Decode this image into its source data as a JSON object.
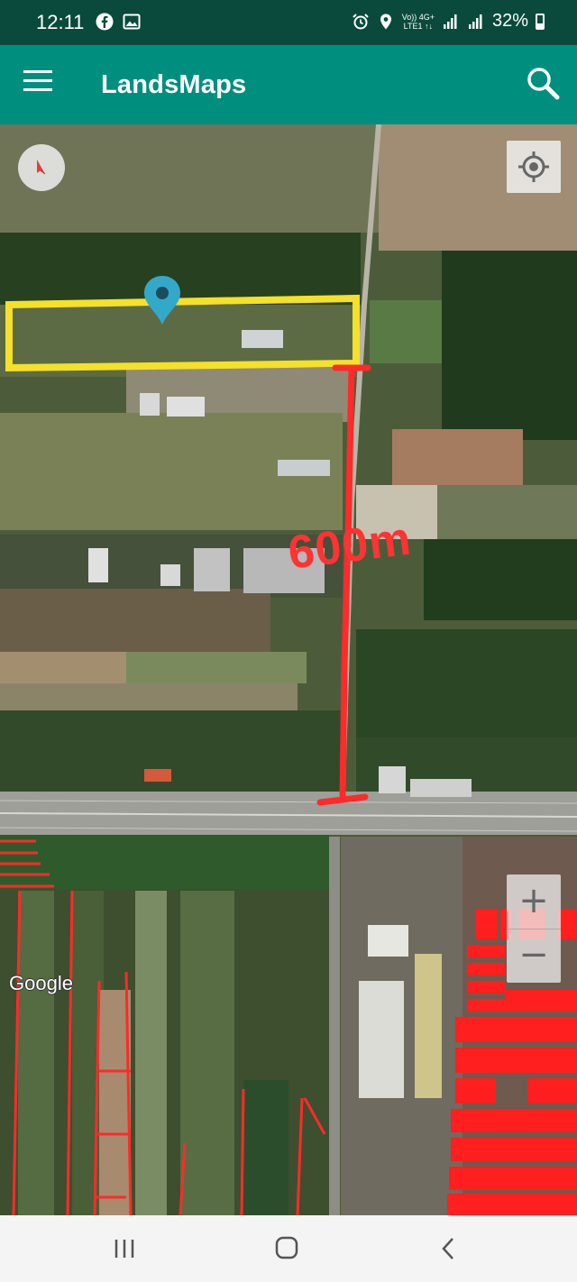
{
  "status_bar": {
    "time": "12:11",
    "network_top": "Vo)) 4G+",
    "network_bottom": "LTE1 ↑↓",
    "battery": "32%",
    "icons": [
      "facebook-icon",
      "image-icon",
      "alarm-icon",
      "location-icon",
      "signal-icon",
      "battery-icon"
    ]
  },
  "app_bar": {
    "title": "LandsMaps",
    "background": "#008f7e"
  },
  "map": {
    "distance_label": "600m",
    "attribution": "Google",
    "zoom_in_label": "+",
    "zoom_out_label": "−",
    "annotation_colors": {
      "parcel_outline": "#f5e02a",
      "measure_line": "#ff2a2a",
      "marker": "#33a9c9"
    }
  }
}
